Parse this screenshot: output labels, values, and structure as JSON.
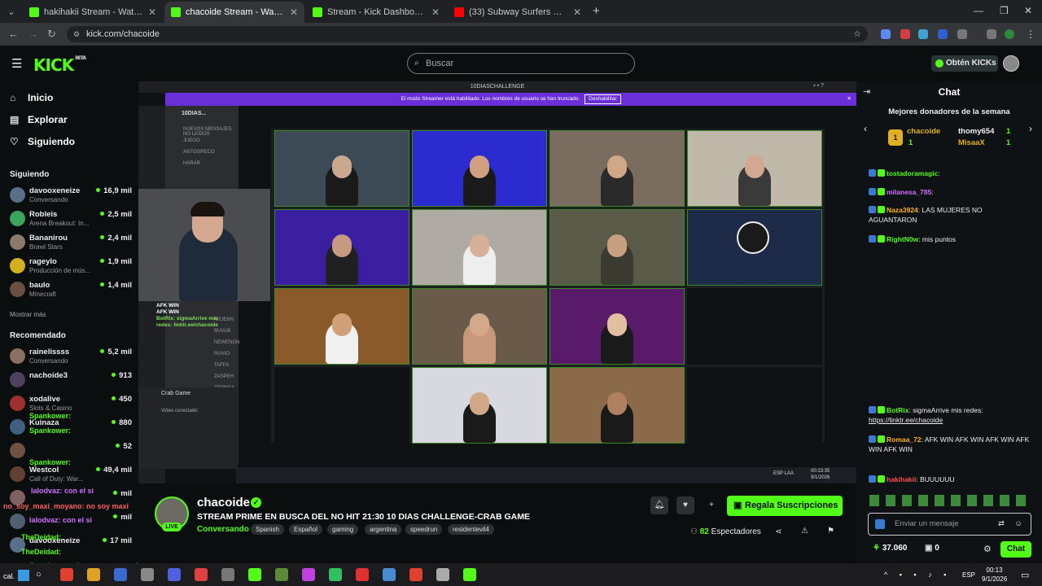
{
  "browser": {
    "tabs": [
      {
        "title": "hakihakii Stream - Watch Live o",
        "color": "#53fc18",
        "active": false
      },
      {
        "title": "chacoide Stream - Watch L",
        "color": "#53fc18",
        "active": true
      },
      {
        "title": "Stream - Kick Dashboard",
        "color": "#53fc18",
        "active": false
      },
      {
        "title": "(33) Subway Surfers Gamplay",
        "color": "#ff0000",
        "active": false
      }
    ],
    "url": "kick.com/chacoide"
  },
  "header": {
    "logo": "KICK",
    "logo_badge": "BETA",
    "search_placeholder": "Buscar",
    "kicks_button": "Obtén KICKs"
  },
  "sidebar": {
    "nav": [
      {
        "label": "Inicio",
        "icon": "home-icon"
      },
      {
        "label": "Explorar",
        "icon": "compass-icon"
      },
      {
        "label": "Siguiendo",
        "icon": "heart-icon"
      }
    ],
    "following_title": "Siguiendo",
    "following": [
      {
        "name": "davooxeneize",
        "game": "Conversando",
        "viewers": "16,9 mil",
        "color": "#5a6f8a"
      },
      {
        "name": "Robleis",
        "game": "Arena Breakout: In...",
        "viewers": "2,5 mil",
        "color": "#3ba55d"
      },
      {
        "name": "Bananirou",
        "game": "Brawl Stars",
        "viewers": "2,4 mil",
        "color": "#8a7a6a"
      },
      {
        "name": "rageylo",
        "game": "Producción de mús...",
        "viewers": "1,9 mil",
        "color": "#d4b020"
      },
      {
        "name": "baulo",
        "game": "Minecraft",
        "viewers": "1,4 mil",
        "color": "#6a5040"
      }
    ],
    "show_more": "Mostrar más",
    "recommended_title": "Recomendado",
    "recommended": [
      {
        "name": "rainelissss",
        "game": "Conversando",
        "viewers": "5,2 mil",
        "color": "#8a7060"
      },
      {
        "name": "nachoide3",
        "game": "",
        "viewers": "913",
        "color": "#504060"
      },
      {
        "name": "xodalive",
        "game": "Slots & Casino",
        "viewers": "450",
        "color": "#a03030"
      },
      {
        "name": "Kuinaza",
        "game": "",
        "viewers": "880",
        "color": "#406080"
      },
      {
        "name": "",
        "game": "",
        "viewers": "52",
        "color": "#705040"
      },
      {
        "name": "Westcol",
        "game": "Call of Duty: War...",
        "viewers": "49,4 mil",
        "color": "#604030"
      },
      {
        "name": "",
        "game": "",
        "viewers": "mil",
        "color": "#806060"
      },
      {
        "name": "",
        "game": "",
        "viewers": "mil",
        "color": "#506070"
      },
      {
        "name": "davooxeneize",
        "game": "",
        "viewers": "17 mil",
        "color": "#5a6f8a"
      }
    ],
    "overlay_chat": [
      {
        "text": "Spankower:",
        "color": "#53fc18"
      },
      {
        "text": "Spankower:",
        "color": "#53fc18"
      },
      {
        "text": "Spankower:",
        "color": "#53fc18"
      },
      {
        "text": "lalodvaz: con el si",
        "color": "#d070ff"
      },
      {
        "text": "no_soy_maxi_moyano: no soy maxi",
        "color": "#ff6060"
      },
      {
        "text": "lalodvaz: con el si",
        "color": "#d070ff"
      },
      {
        "text": "TheDeidad:",
        "color": "#53fc18"
      },
      {
        "text": "TheDeidad:",
        "color": "#53fc18"
      },
      {
        "text": "Spankower: si gana un venezolano reporto el",
        "color": "#53fc18"
      }
    ]
  },
  "video": {
    "discord_title": "10DIASCHALLENGE",
    "banner_text": "El modo Streamer está habilitado. Los nombres de usuario se han truncado.",
    "banner_button": "Deshabilitar",
    "server_name": "10DIAS...",
    "channels": [
      "NUEVOS MENSAJES NO LEIDOS",
      "JUEGO",
      "ANTOGRECO",
      "HARAR",
      "KRJENN",
      "BUVUK",
      "NEWENGN",
      "RUVIO",
      "TAFFA",
      "ZASPEH",
      "ZTONGA"
    ],
    "voice_panel": {
      "title": "Crab Game",
      "status": "Video conectado"
    },
    "overlay_text": [
      "AFK WIN",
      "AFK WIN",
      "BotRix: sigmaArrive mis",
      "redes: linktr.ee/chacoide"
    ],
    "tiles": [
      {
        "bg": "#3b4a55",
        "shirt": "#1a1a1a",
        "skin": "#c9a88f"
      },
      {
        "bg": "#2b2bd0",
        "shirt": "#1a1a1a",
        "skin": "#d0a080"
      },
      {
        "bg": "#7a6d60",
        "shirt": "#2a2a2a",
        "skin": "#d0a888"
      },
      {
        "bg": "#c0b8a8",
        "shirt": "#3a3a3a",
        "skin": "#d4a890"
      },
      {
        "bg": "#3a1fa0",
        "shirt": "#202020",
        "skin": "#c69a80"
      },
      {
        "bg": "#b0aaa5",
        "shirt": "#eeeeee",
        "skin": "#d6b098"
      },
      {
        "bg": "#5a5a48",
        "shirt": "#3a3a30",
        "skin": "#c8a080"
      },
      {
        "bg": "#1d2a48",
        "shirt": "#1d2a48",
        "skin": "#1d2a48"
      },
      {
        "bg": "#8a5a2a",
        "shirt": "#f0f0f0",
        "skin": "#d0a078"
      },
      {
        "bg": "#6a5a4a",
        "shirt": "#c8987a",
        "skin": "#d4a88a"
      },
      {
        "bg": "#5a1a6a",
        "shirt": "#1a1a1a",
        "skin": "#e0c0a0"
      },
      {
        "bg": "#0f1215",
        "shirt": "#0f1215",
        "skin": "#0f1215"
      },
      {
        "bg": "#0f1215",
        "shirt": "#0f1215",
        "skin": "#0f1215"
      },
      {
        "bg": "#d8d8e0",
        "shirt": "#1a1a1a",
        "skin": "#d0a888"
      },
      {
        "bg": "#8a6a48",
        "shirt": "#1a1a1a",
        "skin": "#b08060"
      },
      {
        "bg": "#0f1215",
        "shirt": "#0f1215",
        "skin": "#0f1215"
      }
    ],
    "clock": "00:13:35",
    "date": "9/1/2026",
    "lang": "ESP LAA"
  },
  "stream": {
    "name": "chacoide",
    "live": "LIVE",
    "title": "STREAM PRIME EN BUSCA DEL NO HIT 21:30 10 DIAS CHALLENGE-CRAB GAME",
    "category": "Conversando",
    "tags": [
      "Spanish",
      "Español",
      "gaming",
      "argentina",
      "speedrun",
      "residentevil4"
    ],
    "subscribe_button": "Regala Suscripciones",
    "viewers": "82",
    "viewers_label": "Espectadores"
  },
  "chat": {
    "title": "Chat",
    "donors_title": "Mejores donadores de la semana",
    "donors": [
      {
        "rank": "1",
        "name": "chacoide",
        "count": "1"
      },
      {
        "rank": "2",
        "name": "thomy654",
        "count": "1"
      },
      {
        "rank": "3",
        "name": "MisaaX",
        "count": "1"
      }
    ],
    "messages_top": [
      {
        "user": "tostadoramagic",
        "text": ":",
        "color": "#53fc18"
      },
      {
        "user": "milanesa_785",
        "text": ":",
        "color": "#d070ff"
      },
      {
        "user": "Naza3924",
        "text": ": LAS MUJERES NO AGUANTARON",
        "color": "#ffb020"
      },
      {
        "user": "RightN0w",
        "text": ": mis puntos",
        "color": "#53fc18"
      }
    ],
    "messages_bottom": [
      {
        "user": "BotRix",
        "text": ": sigmaArrive mis redes:",
        "link": "https://linktr.ee/chacoide",
        "color": "#53fc18"
      },
      {
        "user": "Romaa_72",
        "text": ": AFK WIN AFK WIN AFK WIN AFK WIN AFK WIN",
        "color": "#ffb020"
      },
      {
        "user": "hakihakii",
        "text": ": BUUUUUU",
        "color": "#ff5050"
      }
    ],
    "input_placeholder": "Enviar un mensaje",
    "points": "37.060",
    "drops": "0",
    "send_button": "Chat"
  },
  "taskbar": {
    "time": "00:13",
    "date": "9/1/2026",
    "lang": "ESP",
    "weather": "cal."
  }
}
